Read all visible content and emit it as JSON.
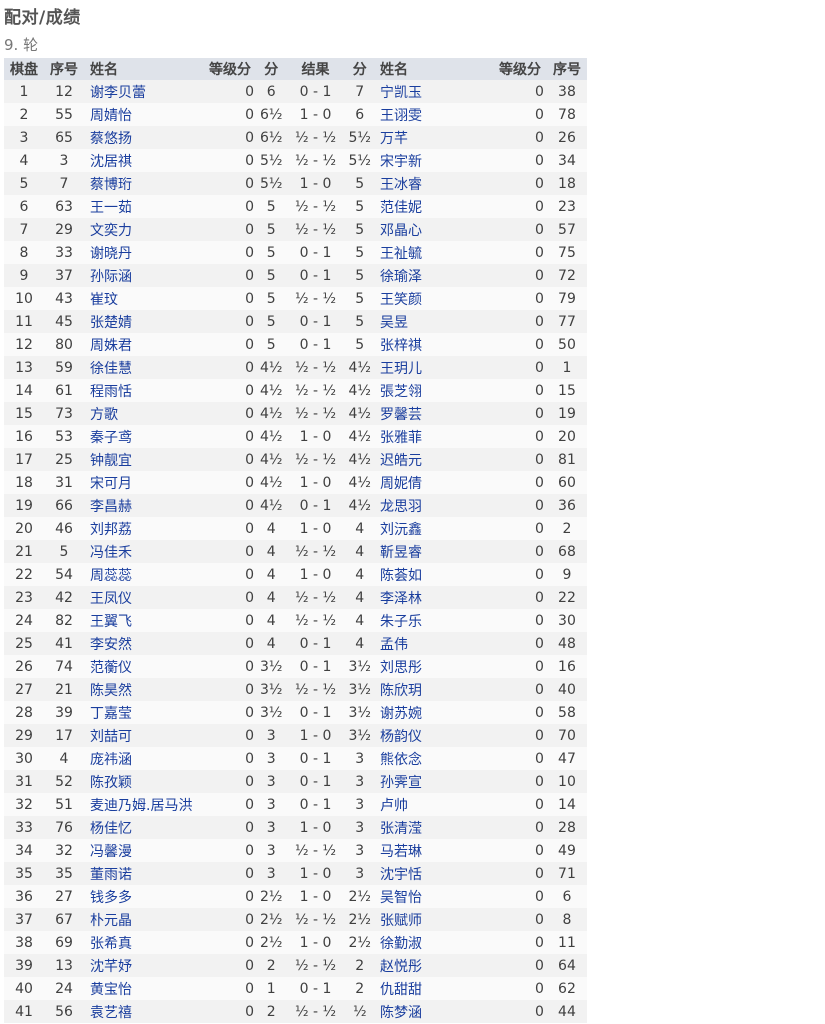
{
  "page": {
    "title": "配对/成绩",
    "round": "9. 轮"
  },
  "headers": [
    "棋盘",
    "序号",
    "姓名",
    "等级分",
    "分",
    "结果",
    "分",
    "姓名",
    "等级分",
    "序号"
  ],
  "rows": [
    [
      "1",
      "12",
      "谢李贝蕾",
      "0",
      "6",
      "0 - 1",
      "7",
      "宁凯玉",
      "0",
      "38"
    ],
    [
      "2",
      "55",
      "周婧怡",
      "0",
      "6½",
      "1 - 0",
      "6",
      "王诩雯",
      "0",
      "78"
    ],
    [
      "3",
      "65",
      "蔡悠扬",
      "0",
      "6½",
      "½ - ½",
      "5½",
      "万芊",
      "0",
      "26"
    ],
    [
      "4",
      "3",
      "沈居祺",
      "0",
      "5½",
      "½ - ½",
      "5½",
      "宋宇新",
      "0",
      "34"
    ],
    [
      "5",
      "7",
      "蔡博珩",
      "0",
      "5½",
      "1 - 0",
      "5",
      "王冰睿",
      "0",
      "18"
    ],
    [
      "6",
      "63",
      "王一茹",
      "0",
      "5",
      "½ - ½",
      "5",
      "范佳妮",
      "0",
      "23"
    ],
    [
      "7",
      "29",
      "文奕力",
      "0",
      "5",
      "½ - ½",
      "5",
      "邓晶心",
      "0",
      "57"
    ],
    [
      "8",
      "33",
      "谢晓丹",
      "0",
      "5",
      "0 - 1",
      "5",
      "王祉毓",
      "0",
      "75"
    ],
    [
      "9",
      "37",
      "孙际涵",
      "0",
      "5",
      "0 - 1",
      "5",
      "徐瑜泽",
      "0",
      "72"
    ],
    [
      "10",
      "43",
      "崔玟",
      "0",
      "5",
      "½ - ½",
      "5",
      "王笑颜",
      "0",
      "79"
    ],
    [
      "11",
      "45",
      "张楚婧",
      "0",
      "5",
      "0 - 1",
      "5",
      "吴昱",
      "0",
      "77"
    ],
    [
      "12",
      "80",
      "周姝君",
      "0",
      "5",
      "0 - 1",
      "5",
      "张梓祺",
      "0",
      "50"
    ],
    [
      "13",
      "59",
      "徐佳慧",
      "0",
      "4½",
      "½ - ½",
      "4½",
      "王玥儿",
      "0",
      "1"
    ],
    [
      "14",
      "61",
      "程雨恬",
      "0",
      "4½",
      "½ - ½",
      "4½",
      "張芝翎",
      "0",
      "15"
    ],
    [
      "15",
      "73",
      "方歌",
      "0",
      "4½",
      "½ - ½",
      "4½",
      "罗馨芸",
      "0",
      "19"
    ],
    [
      "16",
      "53",
      "秦子鸢",
      "0",
      "4½",
      "1 - 0",
      "4½",
      "张雅菲",
      "0",
      "20"
    ],
    [
      "17",
      "25",
      "钟靓宜",
      "0",
      "4½",
      "½ - ½",
      "4½",
      "迟皓元",
      "0",
      "81"
    ],
    [
      "18",
      "31",
      "宋可月",
      "0",
      "4½",
      "1 - 0",
      "4½",
      "周妮倩",
      "0",
      "60"
    ],
    [
      "19",
      "66",
      "李昌赫",
      "0",
      "4½",
      "0 - 1",
      "4½",
      "龙思羽",
      "0",
      "36"
    ],
    [
      "20",
      "46",
      "刘邦荔",
      "0",
      "4",
      "1 - 0",
      "4",
      "刘沅鑫",
      "0",
      "2"
    ],
    [
      "21",
      "5",
      "冯佳禾",
      "0",
      "4",
      "½ - ½",
      "4",
      "靳昱睿",
      "0",
      "68"
    ],
    [
      "22",
      "54",
      "周蕊蕊",
      "0",
      "4",
      "1 - 0",
      "4",
      "陈荟如",
      "0",
      "9"
    ],
    [
      "23",
      "42",
      "王凤仪",
      "0",
      "4",
      "½ - ½",
      "4",
      "李泽林",
      "0",
      "22"
    ],
    [
      "24",
      "82",
      "王翼飞",
      "0",
      "4",
      "½ - ½",
      "4",
      "朱子乐",
      "0",
      "30"
    ],
    [
      "25",
      "41",
      "李安然",
      "0",
      "4",
      "0 - 1",
      "4",
      "孟伟",
      "0",
      "48"
    ],
    [
      "26",
      "74",
      "范蘅仪",
      "0",
      "3½",
      "0 - 1",
      "3½",
      "刘思彤",
      "0",
      "16"
    ],
    [
      "27",
      "21",
      "陈昊然",
      "0",
      "3½",
      "½ - ½",
      "3½",
      "陈欣玥",
      "0",
      "40"
    ],
    [
      "28",
      "39",
      "丁嘉莹",
      "0",
      "3½",
      "0 - 1",
      "3½",
      "谢苏婉",
      "0",
      "58"
    ],
    [
      "29",
      "17",
      "刘喆可",
      "0",
      "3",
      "1 - 0",
      "3½",
      "杨韵仪",
      "0",
      "70"
    ],
    [
      "30",
      "4",
      "庞祎涵",
      "0",
      "3",
      "0 - 1",
      "3",
      "熊依念",
      "0",
      "47"
    ],
    [
      "31",
      "52",
      "陈孜颖",
      "0",
      "3",
      "0 - 1",
      "3",
      "孙霁宣",
      "0",
      "10"
    ],
    [
      "32",
      "51",
      "麦迪乃姆.居马洪",
      "0",
      "3",
      "0 - 1",
      "3",
      "卢帅",
      "0",
      "14"
    ],
    [
      "33",
      "76",
      "杨佳忆",
      "0",
      "3",
      "1 - 0",
      "3",
      "张清滢",
      "0",
      "28"
    ],
    [
      "34",
      "32",
      "冯馨漫",
      "0",
      "3",
      "½ - ½",
      "3",
      "马若琳",
      "0",
      "49"
    ],
    [
      "35",
      "35",
      "董雨诺",
      "0",
      "3",
      "1 - 0",
      "3",
      "沈宇恬",
      "0",
      "71"
    ],
    [
      "36",
      "27",
      "钱多多",
      "0",
      "2½",
      "1 - 0",
      "2½",
      "吴智怡",
      "0",
      "6"
    ],
    [
      "37",
      "67",
      "朴元晶",
      "0",
      "2½",
      "½ - ½",
      "2½",
      "张赋师",
      "0",
      "8"
    ],
    [
      "38",
      "69",
      "张希真",
      "0",
      "2½",
      "1 - 0",
      "2½",
      "徐勤淑",
      "0",
      "11"
    ],
    [
      "39",
      "13",
      "沈芊妤",
      "0",
      "2",
      "½ - ½",
      "2",
      "赵悦彤",
      "0",
      "64"
    ],
    [
      "40",
      "24",
      "黄宝怡",
      "0",
      "1",
      "0 - 1",
      "2",
      "仇甜甜",
      "0",
      "62"
    ],
    [
      "41",
      "56",
      "袁艺禧",
      "0",
      "2",
      "½ - ½",
      "½",
      "陈梦涵",
      "0",
      "44"
    ]
  ]
}
